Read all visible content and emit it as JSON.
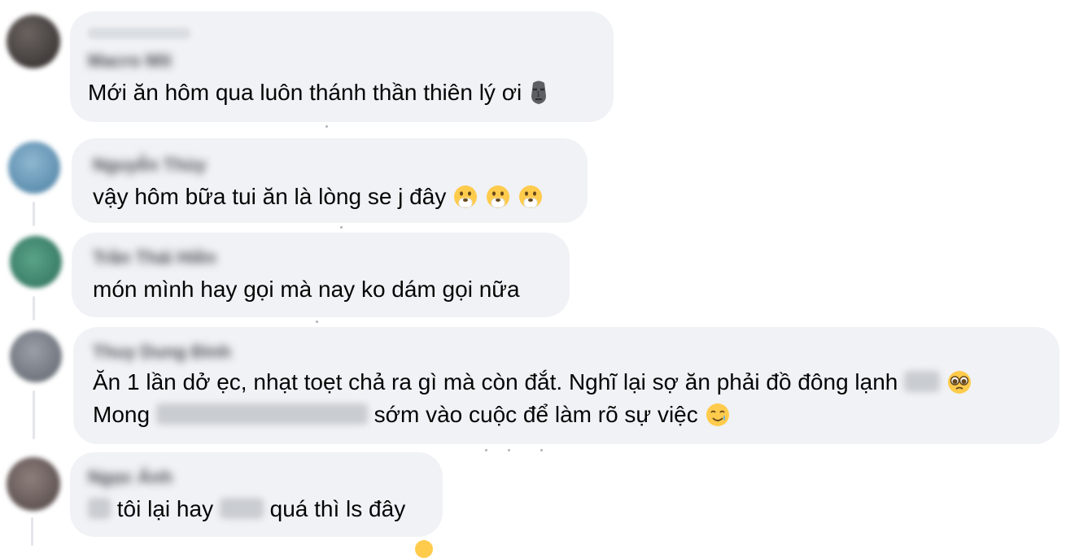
{
  "comments": [
    {
      "name": "Macro Mít",
      "meta": "Fan cứng",
      "lines": [
        {
          "text": "Mới ăn hôm qua luôn thánh thần thiên lý ơi"
        }
      ],
      "emoji": "moai-icon"
    },
    {
      "name": "Nguyễn Thùy",
      "lines": [
        {
          "text": "vậy hôm bữa tui ăn là lòng se j đây"
        }
      ],
      "emoji": "hand-over-mouth-icon"
    },
    {
      "name": "Trần Thái Hiền",
      "lines": [
        {
          "text": "món mình hay gọi mà nay ko dám gọi nữa"
        }
      ]
    },
    {
      "name": "Thuy Dung Đinh",
      "lines": [
        {
          "text": "Ăn 1 lần dở ẹc, nhạt toẹt chả ra gì mà còn đắt. Nghĩ lại sợ ăn phải đồ đông lạnh"
        },
        {
          "prefix": "Mong",
          "suffix": "sớm vào cuộc để làm rõ sự việc"
        }
      ],
      "emojis": [
        "pleading-face-icon",
        "smiling-tear-icon"
      ]
    },
    {
      "name": "Ngọc Ánh",
      "lines": [
        {
          "part1": "tôi lại hay",
          "part2": "quá thì ls đây"
        }
      ]
    }
  ],
  "colors": {
    "bubble": "#f0f2f5",
    "text": "#050505",
    "thread": "#e4e6eb",
    "emoji_yellow": "#ffcb4c"
  }
}
